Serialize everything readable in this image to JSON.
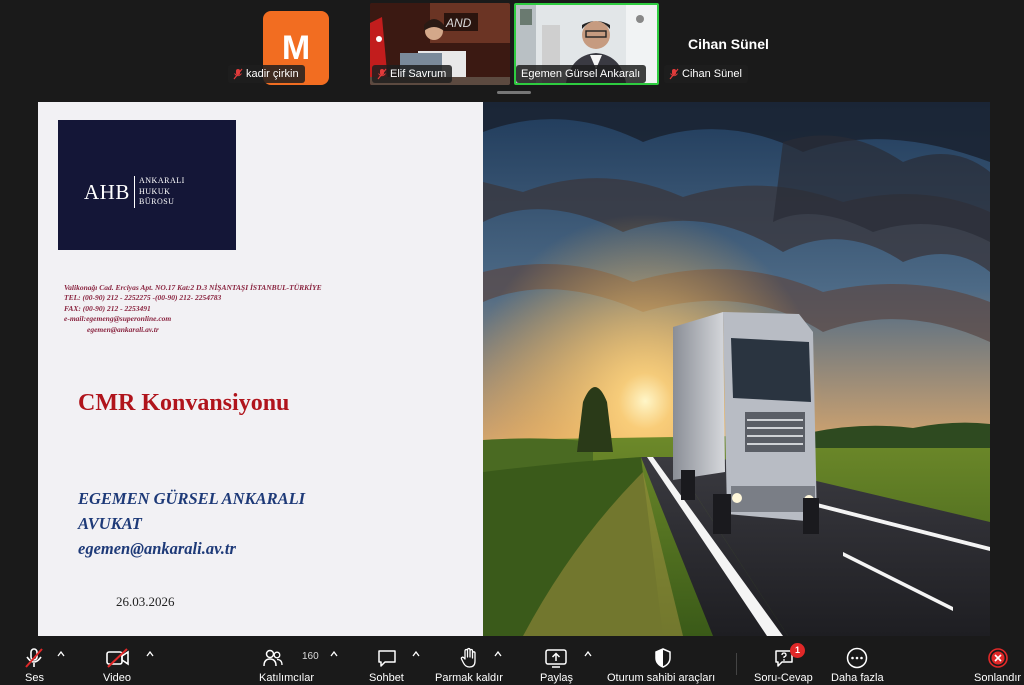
{
  "participants": [
    {
      "name": "kadir çirkin",
      "initial": "M",
      "muted": true
    },
    {
      "name": "Elif Savrum",
      "muted": true
    },
    {
      "name": "Egemen Gürsel Ankaralı",
      "muted": false,
      "active_speaker": true
    },
    {
      "name": "Cihan Sünel",
      "muted": true
    }
  ],
  "featured_name": "Cihan Sünel",
  "slide": {
    "logo": {
      "short": "AHB",
      "line1": "ANKARALI",
      "line2": "HUKUK",
      "line3": "BÜROSU"
    },
    "address": [
      "Valikonağı Cad. Erciyas Apt. NO.17 Kat:2  D.3 NİŞANTAŞI İSTANBUL-TÜRKİYE",
      "TEL: (00-90) 212 - 2252275 -(00-90) 212-  2254783",
      "FAX: (00-90) 212 - 2253491",
      "e-mail:egemeng@superonline.com",
      "egemen@ankarali.av.tr"
    ],
    "title": "CMR Konvansiyonu",
    "author_name": "EGEMEN GÜRSEL ANKARALI",
    "author_role": "AVUKAT",
    "author_email": "egemen@ankarali.av.tr",
    "date": "26.03.2026"
  },
  "toolbar": {
    "audio": "Ses",
    "video": "Video",
    "participants": "Katılımcılar",
    "participants_count": "160",
    "chat": "Sohbet",
    "raise_hand": "Parmak kaldır",
    "share": "Paylaş",
    "host_tools": "Oturum sahibi araçları",
    "qa": "Soru-Cevap",
    "qa_badge": "1",
    "more": "Daha fazla",
    "end": "Sonlandır"
  },
  "colors": {
    "avatar": "#f26d21",
    "active_speaker_border": "#2ecc40",
    "slide_title": "#b0141c",
    "author": "#1e3a78",
    "address": "#8a2540",
    "logo_bg": "#141637",
    "end_button": "#e02828"
  }
}
